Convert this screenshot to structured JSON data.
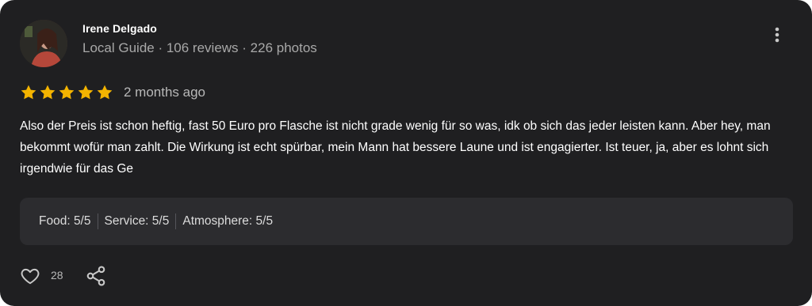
{
  "reviewer": {
    "name": "Irene Delgado",
    "meta": "Local Guide · 106 reviews · 226 photos"
  },
  "rating": {
    "stars": 5,
    "max": 5,
    "time": "2 months ago",
    "star_color": "#f4b400"
  },
  "review_text": "Also der Preis ist schon heftig, fast 50 Euro pro Flasche ist nicht grade wenig für so was, idk ob sich das jeder leisten kann. Aber hey, man bekommt wofür man zahlt. Die Wirkung ist echt spürbar, mein Mann hat bessere Laune und ist engagierter. Ist teuer, ja, aber es lohnt sich irgendwie für das Ge",
  "sub_ratings": [
    {
      "label": "Food: 5/5"
    },
    {
      "label": "Service: 5/5"
    },
    {
      "label": "Atmosphere: 5/5"
    }
  ],
  "actions": {
    "like_count": "28"
  },
  "icons": {
    "menu": "more-vertical-icon",
    "like": "heart-icon",
    "share": "share-icon"
  }
}
